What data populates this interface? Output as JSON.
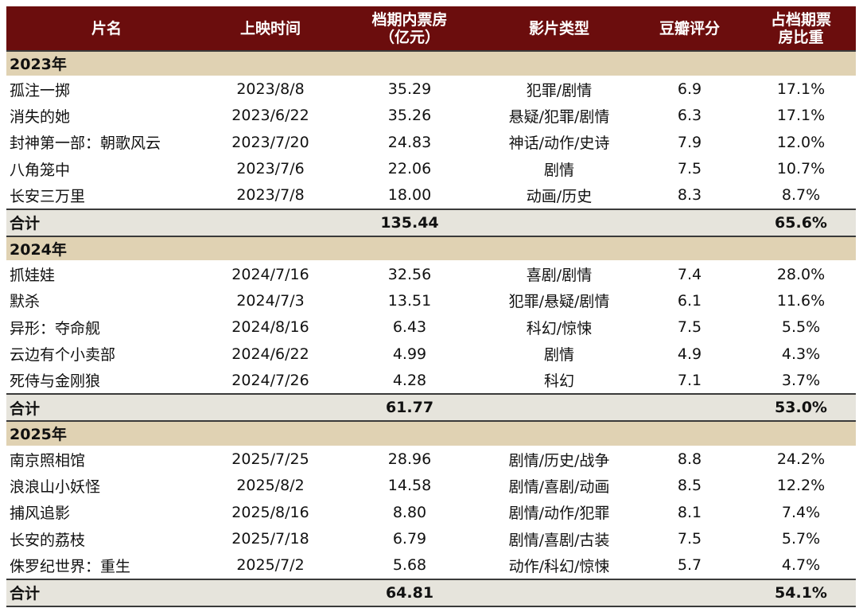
{
  "header": {
    "col_name": "片名",
    "col_date": "上映时间",
    "col_box_line1": "档期内票房",
    "col_box_line2": "（亿元）",
    "col_genre": "影片类型",
    "col_rating": "豆瓣评分",
    "col_share_line1": "占档期票",
    "col_share_line2": "房比重"
  },
  "sections": [
    {
      "year": "2023年",
      "rows": [
        {
          "name": "孤注一掷",
          "date": "2023/8/8",
          "box": "35.29",
          "genre": "犯罪/剧情",
          "rating": "6.9",
          "share": "17.1%"
        },
        {
          "name": "消失的她",
          "date": "2023/6/22",
          "box": "35.26",
          "genre": "悬疑/犯罪/剧情",
          "rating": "6.3",
          "share": "17.1%"
        },
        {
          "name": "封神第一部：朝歌风云",
          "date": "2023/7/20",
          "box": "24.83",
          "genre": "神话/动作/史诗",
          "rating": "7.9",
          "share": "12.0%"
        },
        {
          "name": "八角笼中",
          "date": "2023/7/6",
          "box": "22.06",
          "genre": "剧情",
          "rating": "7.5",
          "share": "10.7%"
        },
        {
          "name": "长安三万里",
          "date": "2023/7/8",
          "box": "18.00",
          "genre": "动画/历史",
          "rating": "8.3",
          "share": "8.7%"
        }
      ],
      "total": {
        "label": "合计",
        "box": "135.44",
        "share": "65.6%"
      }
    },
    {
      "year": "2024年",
      "rows": [
        {
          "name": "抓娃娃",
          "date": "2024/7/16",
          "box": "32.56",
          "genre": "喜剧/剧情",
          "rating": "7.4",
          "share": "28.0%"
        },
        {
          "name": "默杀",
          "date": "2024/7/3",
          "box": "13.51",
          "genre": "犯罪/悬疑/剧情",
          "rating": "6.1",
          "share": "11.6%"
        },
        {
          "name": "异形：夺命舰",
          "date": "2024/8/16",
          "box": "6.43",
          "genre": "科幻/惊悚",
          "rating": "7.5",
          "share": "5.5%"
        },
        {
          "name": "云边有个小卖部",
          "date": "2024/6/22",
          "box": "4.99",
          "genre": "剧情",
          "rating": "4.9",
          "share": "4.3%"
        },
        {
          "name": "死侍与金刚狼",
          "date": "2024/7/26",
          "box": "4.28",
          "genre": "科幻",
          "rating": "7.1",
          "share": "3.7%"
        }
      ],
      "total": {
        "label": "合计",
        "box": "61.77",
        "share": "53.0%"
      }
    },
    {
      "year": "2025年",
      "rows": [
        {
          "name": "南京照相馆",
          "date": "2025/7/25",
          "box": "28.96",
          "genre": "剧情/历史/战争",
          "rating": "8.8",
          "share": "24.2%"
        },
        {
          "name": "浪浪山小妖怪",
          "date": "2025/8/2",
          "box": "14.58",
          "genre": "剧情/喜剧/动画",
          "rating": "8.5",
          "share": "12.2%"
        },
        {
          "name": "捕风追影",
          "date": "2025/8/16",
          "box": "8.80",
          "genre": "剧情/动作/犯罪",
          "rating": "8.1",
          "share": "7.4%"
        },
        {
          "name": "长安的荔枝",
          "date": "2025/7/18",
          "box": "6.79",
          "genre": "剧情/喜剧/古装",
          "rating": "7.5",
          "share": "5.7%"
        },
        {
          "name": "侏罗纪世界：重生",
          "date": "2025/7/2",
          "box": "5.68",
          "genre": "动作/科幻/惊悚",
          "rating": "5.7",
          "share": "4.7%"
        }
      ],
      "total": {
        "label": "合计",
        "box": "64.81",
        "share": "54.1%"
      }
    }
  ],
  "colors": {
    "header_bg": "#6b0d0d",
    "section_bg": "#e0d2b3",
    "total_bg": "#e6e4dc"
  }
}
